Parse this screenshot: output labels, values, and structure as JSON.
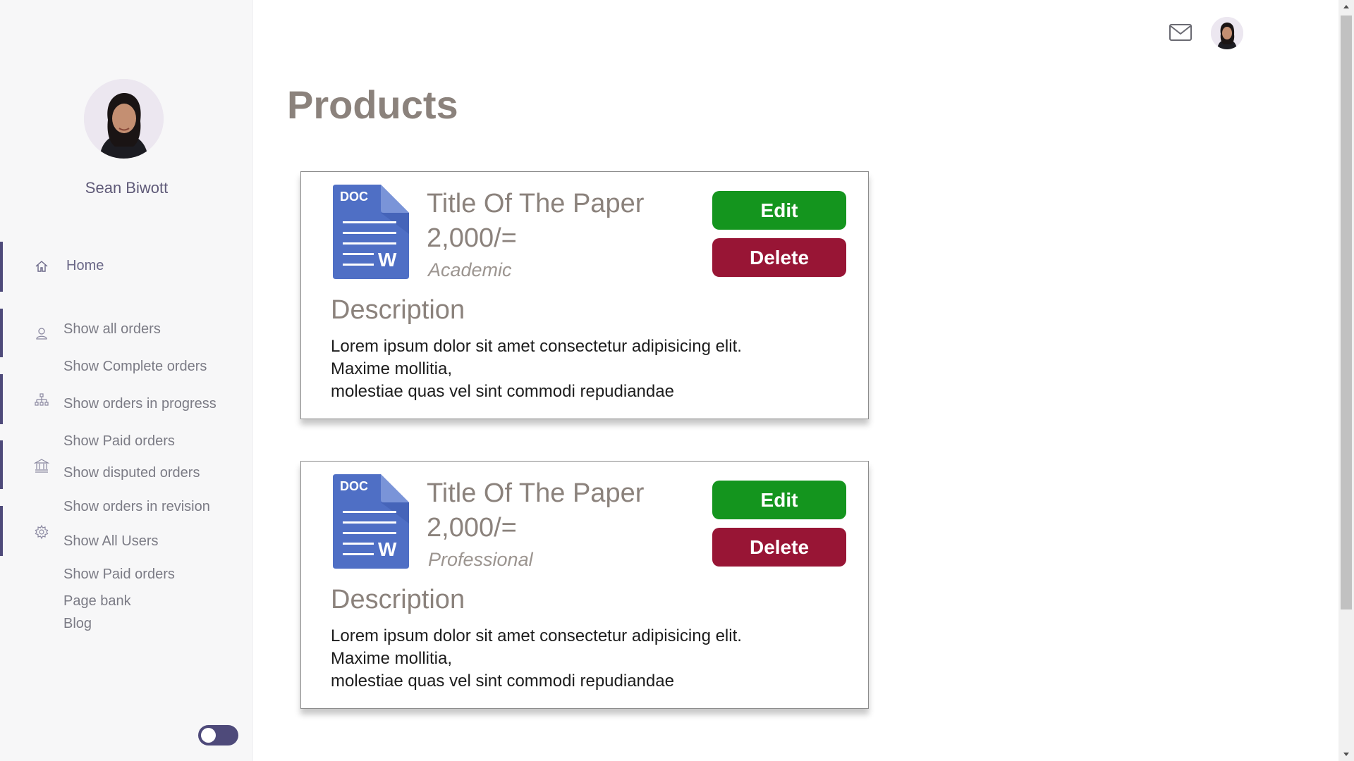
{
  "sidebar": {
    "user_name": "Sean Biwott",
    "items": [
      {
        "label": "Home",
        "icon": "home-icon"
      },
      {
        "label": "Show all orders",
        "icon": "user-icon"
      },
      {
        "label": "Show Complete orders"
      },
      {
        "label": "Show orders in progress",
        "icon": "sitemap-icon"
      },
      {
        "label": "Show Paid orders"
      },
      {
        "label": "Show disputed orders",
        "icon": "bank-icon"
      },
      {
        "label": "Show orders in revision"
      },
      {
        "label": "Show All Users",
        "icon": "gear-icon"
      },
      {
        "label": "Show Paid orders"
      },
      {
        "label": "Page bank"
      },
      {
        "label": "Blog"
      }
    ],
    "theme_toggle": "dark-mode-toggle"
  },
  "header": {
    "mail_icon": "mail-icon",
    "avatar_icon": "avatar"
  },
  "page": {
    "title": "Products"
  },
  "products": [
    {
      "icon": "doc-file-icon",
      "icon_text": "DOC",
      "icon_letter": "W",
      "title": "Title Of The Paper",
      "price": "2,000/=",
      "category": "Academic",
      "edit_label": "Edit",
      "delete_label": "Delete",
      "description_heading": "Description",
      "description_lines": [
        "Lorem ipsum dolor sit amet consectetur adipisicing elit.",
        "Maxime mollitia,",
        "molestiae quas vel sint commodi repudiandae"
      ]
    },
    {
      "icon": "doc-file-icon",
      "icon_text": "DOC",
      "icon_letter": "W",
      "title": "Title Of The Paper",
      "price": "2,000/=",
      "category": "Professional",
      "edit_label": "Edit",
      "delete_label": "Delete",
      "description_heading": "Description",
      "description_lines": [
        "Lorem ipsum dolor sit amet consectetur adipisicing elit.",
        "Maxime mollitia,",
        "molestiae quas vel sint commodi repudiandae"
      ]
    }
  ],
  "colors": {
    "accent": "#4e4a7a",
    "edit": "#14951e",
    "delete": "#981535",
    "heading": "#8b827c",
    "doc_blue": "#4f6fc5"
  }
}
